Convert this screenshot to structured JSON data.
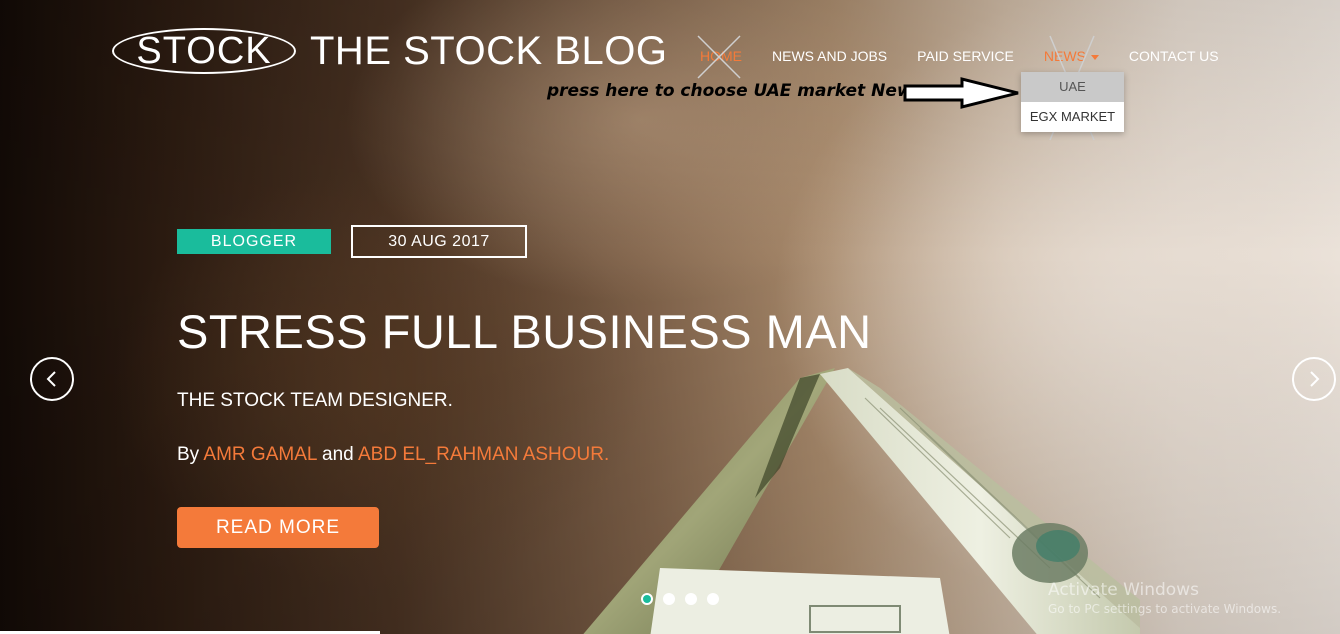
{
  "logo": {
    "oval_text": "STOCK",
    "title": "THE STOCK BLOG"
  },
  "nav": {
    "items": [
      {
        "label": "HOME"
      },
      {
        "label": "NEWS AND JOBS"
      },
      {
        "label": "PAID SERVICE"
      },
      {
        "label": "NEWS"
      },
      {
        "label": "CONTACT US"
      }
    ],
    "dropdown": [
      {
        "label": "UAE"
      },
      {
        "label": "EGX MARKET"
      }
    ]
  },
  "annotation": {
    "text": "press here to choose UAE market News"
  },
  "hero": {
    "tag": "BLOGGER",
    "date": "30 AUG 2017",
    "headline": "STRESS FULL BUSINESS MAN",
    "subline": "THE STOCK TEAM DESIGNER.",
    "by_prefix": "By",
    "author1": "AMR GAMAL",
    "and_word": "and",
    "author2": "ABD EL_RAHMAN ASHOUR.",
    "cta": "READ MORE"
  },
  "watermark": {
    "title": "Activate Windows",
    "subtitle": "Go to PC settings to activate Windows."
  },
  "colors": {
    "accent": "#f47a3a",
    "teal": "#1abc9c",
    "text": "#ffffff"
  },
  "icons": {
    "prev": "chevron-left-icon",
    "next": "chevron-right-icon"
  },
  "carousel": {
    "slide_count": 4,
    "active_slide": 1
  }
}
